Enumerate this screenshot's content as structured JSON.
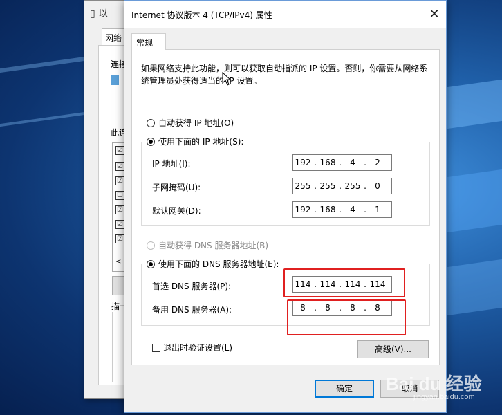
{
  "back_window": {
    "title_fragment": "以",
    "tab_label": "网络",
    "label_connect": "连接",
    "label_items": "此连",
    "label_desc": "描",
    "checks": [
      "☑",
      "☑",
      "☑",
      "☐",
      "☑",
      "☑",
      "☑"
    ],
    "scroll_left": "<"
  },
  "dialog": {
    "title": "Internet 协议版本 4 (TCP/IPv4) 属性",
    "close": "✕",
    "tab": "常规",
    "description": "如果网络支持此功能，则可以获取自动指派的 IP 设置。否则，你需要从网络系统管理员处获得适当的 IP 设置。",
    "ip_auto": "自动获得 IP 地址(O)",
    "ip_manual": "使用下面的 IP 地址(S):",
    "ip_address_label": "IP 地址(I):",
    "ip_address": [
      "192",
      "168",
      "4",
      "2"
    ],
    "subnet_label": "子网掩码(U):",
    "subnet": [
      "255",
      "255",
      "255",
      "0"
    ],
    "gateway_label": "默认网关(D):",
    "gateway": [
      "192",
      "168",
      "4",
      "1"
    ],
    "dns_auto": "自动获得 DNS 服务器地址(B)",
    "dns_manual": "使用下面的 DNS 服务器地址(E):",
    "dns_pref_label": "首选 DNS 服务器(P):",
    "dns_pref": [
      "114",
      "114",
      "114",
      "114"
    ],
    "dns_alt_label": "备用 DNS 服务器(A):",
    "dns_alt": [
      "8",
      "8",
      "8",
      "8"
    ],
    "validate_on_exit": "退出时验证设置(L)",
    "advanced": "高级(V)...",
    "ok": "确定",
    "cancel": "取消"
  },
  "watermark": {
    "logo": "Bai du 经验",
    "url": "jingyan.baidu.com"
  },
  "colors": {
    "highlight": "#e02020",
    "accent": "#0078d7"
  }
}
